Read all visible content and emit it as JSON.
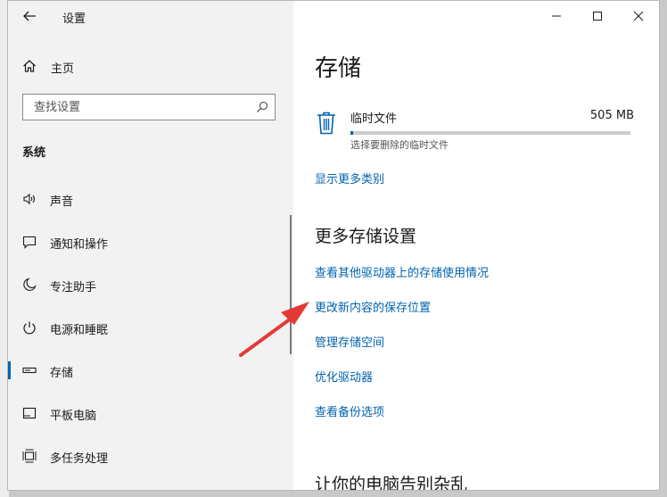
{
  "app": {
    "title": "设置"
  },
  "sidebar": {
    "home_label": "主页",
    "search_placeholder": "查找设置",
    "section_title": "系统",
    "items": [
      {
        "label": "声音",
        "icon": "speaker-icon"
      },
      {
        "label": "通知和操作",
        "icon": "notification-icon"
      },
      {
        "label": "专注助手",
        "icon": "moon-icon"
      },
      {
        "label": "电源和睡眠",
        "icon": "power-icon"
      },
      {
        "label": "存储",
        "icon": "storage-icon",
        "active": true
      },
      {
        "label": "平板电脑",
        "icon": "tablet-icon"
      },
      {
        "label": "多任务处理",
        "icon": "multitask-icon"
      }
    ]
  },
  "main": {
    "title": "存储",
    "temp_files": {
      "label": "临时文件",
      "size": "505 MB",
      "description": "选择要删除的临时文件",
      "usage_fraction": 0.01
    },
    "show_more_link": "显示更多类别",
    "more_settings_title": "更多存储设置",
    "links": [
      "查看其他驱动器上的存储使用情况",
      "更改新内容的保存位置",
      "管理存储空间",
      "优化驱动器",
      "查看备份选项"
    ],
    "bottom_title": "让你的电脑告别杂乱"
  },
  "colors": {
    "accent": "#0063b1",
    "annotation_arrow": "#e53935"
  }
}
